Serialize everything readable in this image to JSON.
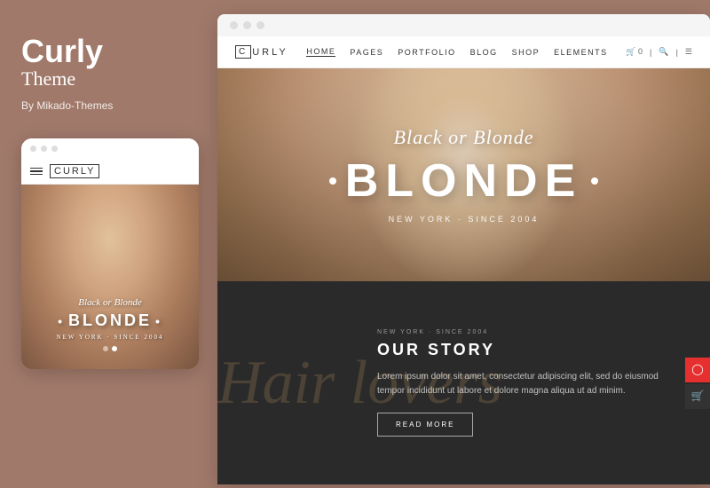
{
  "left_panel": {
    "brand_name": "Curly",
    "brand_subtitle": "Theme",
    "brand_by": "By Mikado-Themes"
  },
  "mobile_mockup": {
    "logo": "CURLY",
    "logo_bracket_letter": "C",
    "hero_text_script": "Black or Blonde",
    "hero_text_main": "BLONDE",
    "hero_sub": "NEW YORK · SINCE 2004"
  },
  "desktop_mockup": {
    "nav": {
      "logo": "CURLY",
      "logo_bracket_letter": "C",
      "links": [
        "HOME",
        "PAGES",
        "PORTFOLIO",
        "BLOG",
        "SHOP",
        "ELEMENTS"
      ],
      "active_link": "HOME"
    },
    "hero": {
      "script_text": "Black or Blonde",
      "main_text": "BLONDE",
      "sub_text": "NEW YORK · SINCE 2004"
    },
    "story": {
      "tag": "NEW YORK · SINCE 2004",
      "title": "OUR STORY",
      "body": "Lorem ipsum dolor sit amet, consectetur adipiscing elit, sed do eiusmod tempor incididunt ut labore et dolore magna aliqua ut ad minim.",
      "button_label": "READ MORE",
      "bg_script": "Hair lovers"
    }
  }
}
